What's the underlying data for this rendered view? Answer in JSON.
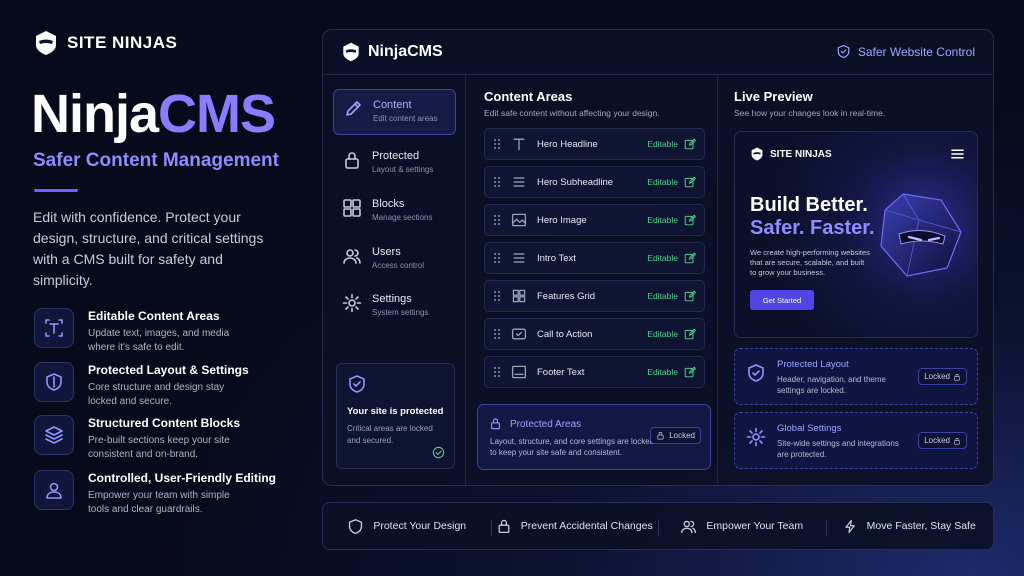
{
  "brand": {
    "name": "SITE NINJAS"
  },
  "hero": {
    "title_a": "Ninja",
    "title_b": "CMS",
    "subtitle": "Safer Content Management",
    "description": "Edit with confidence. Protect your design, structure, and critical settings with a CMS built for safety and simplicity."
  },
  "features": [
    {
      "icon": "text-icon",
      "title": "Editable Content Areas",
      "desc": "Update text, images, and media where it's safe to edit."
    },
    {
      "icon": "shield-icon",
      "title": "Protected Layout & Settings",
      "desc": "Core structure and design stay locked and secure."
    },
    {
      "icon": "layers-icon",
      "title": "Structured Content Blocks",
      "desc": "Pre-built sections keep your site consistent and on-brand."
    },
    {
      "icon": "user-icon",
      "title": "Controlled, User-Friendly Editing",
      "desc": "Empower your team with simple tools and clear guardrails."
    }
  ],
  "window": {
    "app_name": "NinjaCMS",
    "safer_label": "Safer Website Control"
  },
  "sidebar": {
    "items": [
      {
        "icon": "pencil-icon",
        "title": "Content",
        "desc": "Edit content areas",
        "active": true
      },
      {
        "icon": "lock-icon",
        "title": "Protected",
        "desc": "Layout & settings"
      },
      {
        "icon": "grid-icon",
        "title": "Blocks",
        "desc": "Manage sections"
      },
      {
        "icon": "users-icon",
        "title": "Users",
        "desc": "Access control"
      },
      {
        "icon": "gear-icon",
        "title": "Settings",
        "desc": "System settings"
      }
    ],
    "protected_card": {
      "title": "Your site is protected",
      "desc": "Critical areas are locked and secured."
    }
  },
  "content_areas": {
    "title": "Content Areas",
    "desc": "Edit safe content without affecting your design.",
    "editable_label": "Editable",
    "rows": [
      {
        "icon": "text-icon",
        "label": "Hero Headline"
      },
      {
        "icon": "lines-icon",
        "label": "Hero Subheadline"
      },
      {
        "icon": "image-icon",
        "label": "Hero Image"
      },
      {
        "icon": "lines-icon",
        "label": "Intro Text"
      },
      {
        "icon": "grid-icon",
        "label": "Features Grid"
      },
      {
        "icon": "cta-icon",
        "label": "Call to Action"
      },
      {
        "icon": "footer-icon",
        "label": "Footer Text"
      }
    ],
    "protected": {
      "title": "Protected Areas",
      "desc": "Layout, structure, and core settings are locked to keep your site safe and consistent.",
      "lock_label": "Locked"
    }
  },
  "preview": {
    "title": "Live Preview",
    "desc": "See how your changes look in real-time.",
    "brand": "SITE NINJAS",
    "headline_a": "Build Better.",
    "headline_b": "Safer. Faster.",
    "body": "We create high-performing websites that are secure, scalable, and built to grow your business.",
    "cta": "Get Started"
  },
  "lock_cards": [
    {
      "icon": "shield-icon",
      "title": "Protected Layout",
      "desc": "Header, navigation, and theme settings are locked.",
      "lock_label": "Locked"
    },
    {
      "icon": "gear-icon",
      "title": "Global Settings",
      "desc": "Site-wide settings and integrations are protected.",
      "lock_label": "Locked"
    }
  ],
  "bottom_bar": [
    {
      "icon": "shield-icon",
      "label": "Protect Your Design"
    },
    {
      "icon": "lock-icon",
      "label": "Prevent Accidental Changes"
    },
    {
      "icon": "users-icon",
      "label": "Empower Your Team"
    },
    {
      "icon": "bolt-icon",
      "label": "Move Faster, Stay Safe"
    }
  ],
  "colors": {
    "accent": "#8b7cff",
    "editable": "#4fd18b",
    "button": "#5046e5"
  }
}
